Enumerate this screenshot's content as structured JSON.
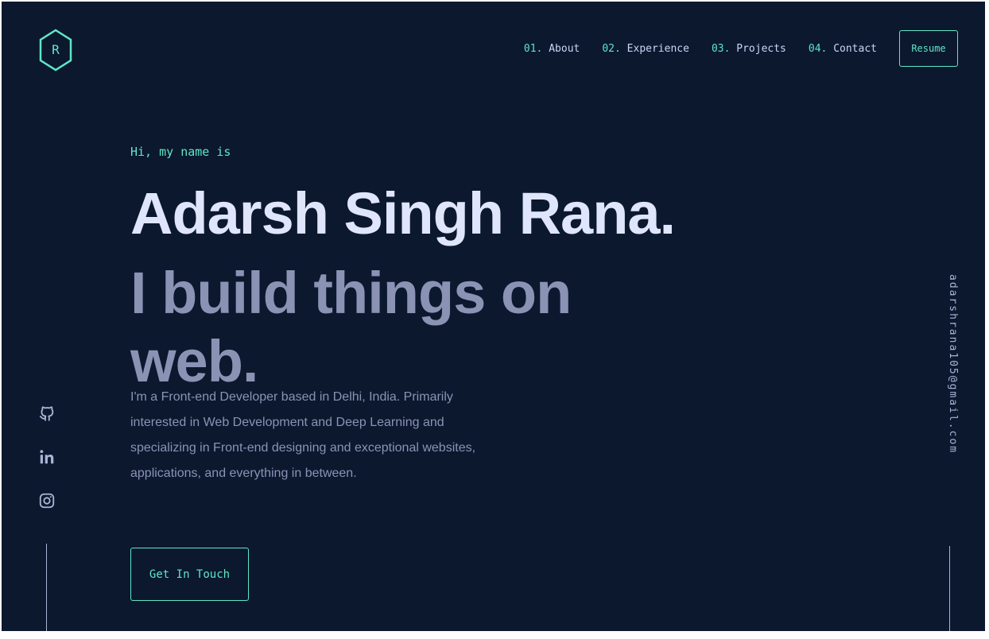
{
  "logo": {
    "letter": "R"
  },
  "nav": {
    "items": [
      {
        "num": "01.",
        "label": "About"
      },
      {
        "num": "02.",
        "label": "Experience"
      },
      {
        "num": "03.",
        "label": "Projects"
      },
      {
        "num": "04.",
        "label": "Contact"
      }
    ],
    "resume_label": "Resume"
  },
  "hero": {
    "intro": "Hi, my name is",
    "name": "Adarsh Singh Rana.",
    "tagline": "I build things on web.",
    "bio": "I'm a Front-end Developer based in Delhi, India. Primarily interested in Web Development and Deep Learning and specializing in Front-end designing and exceptional websites, applications, and everything in between.",
    "cta_label": "Get In Touch"
  },
  "social": {
    "icons": [
      "github-icon",
      "linkedin-icon",
      "instagram-icon"
    ]
  },
  "email": "adarshrana105@gmail.com",
  "colors": {
    "background": "#0b182e",
    "accent": "#5fe6c8",
    "heading": "#dfe5fa",
    "muted": "#8a93b4"
  }
}
